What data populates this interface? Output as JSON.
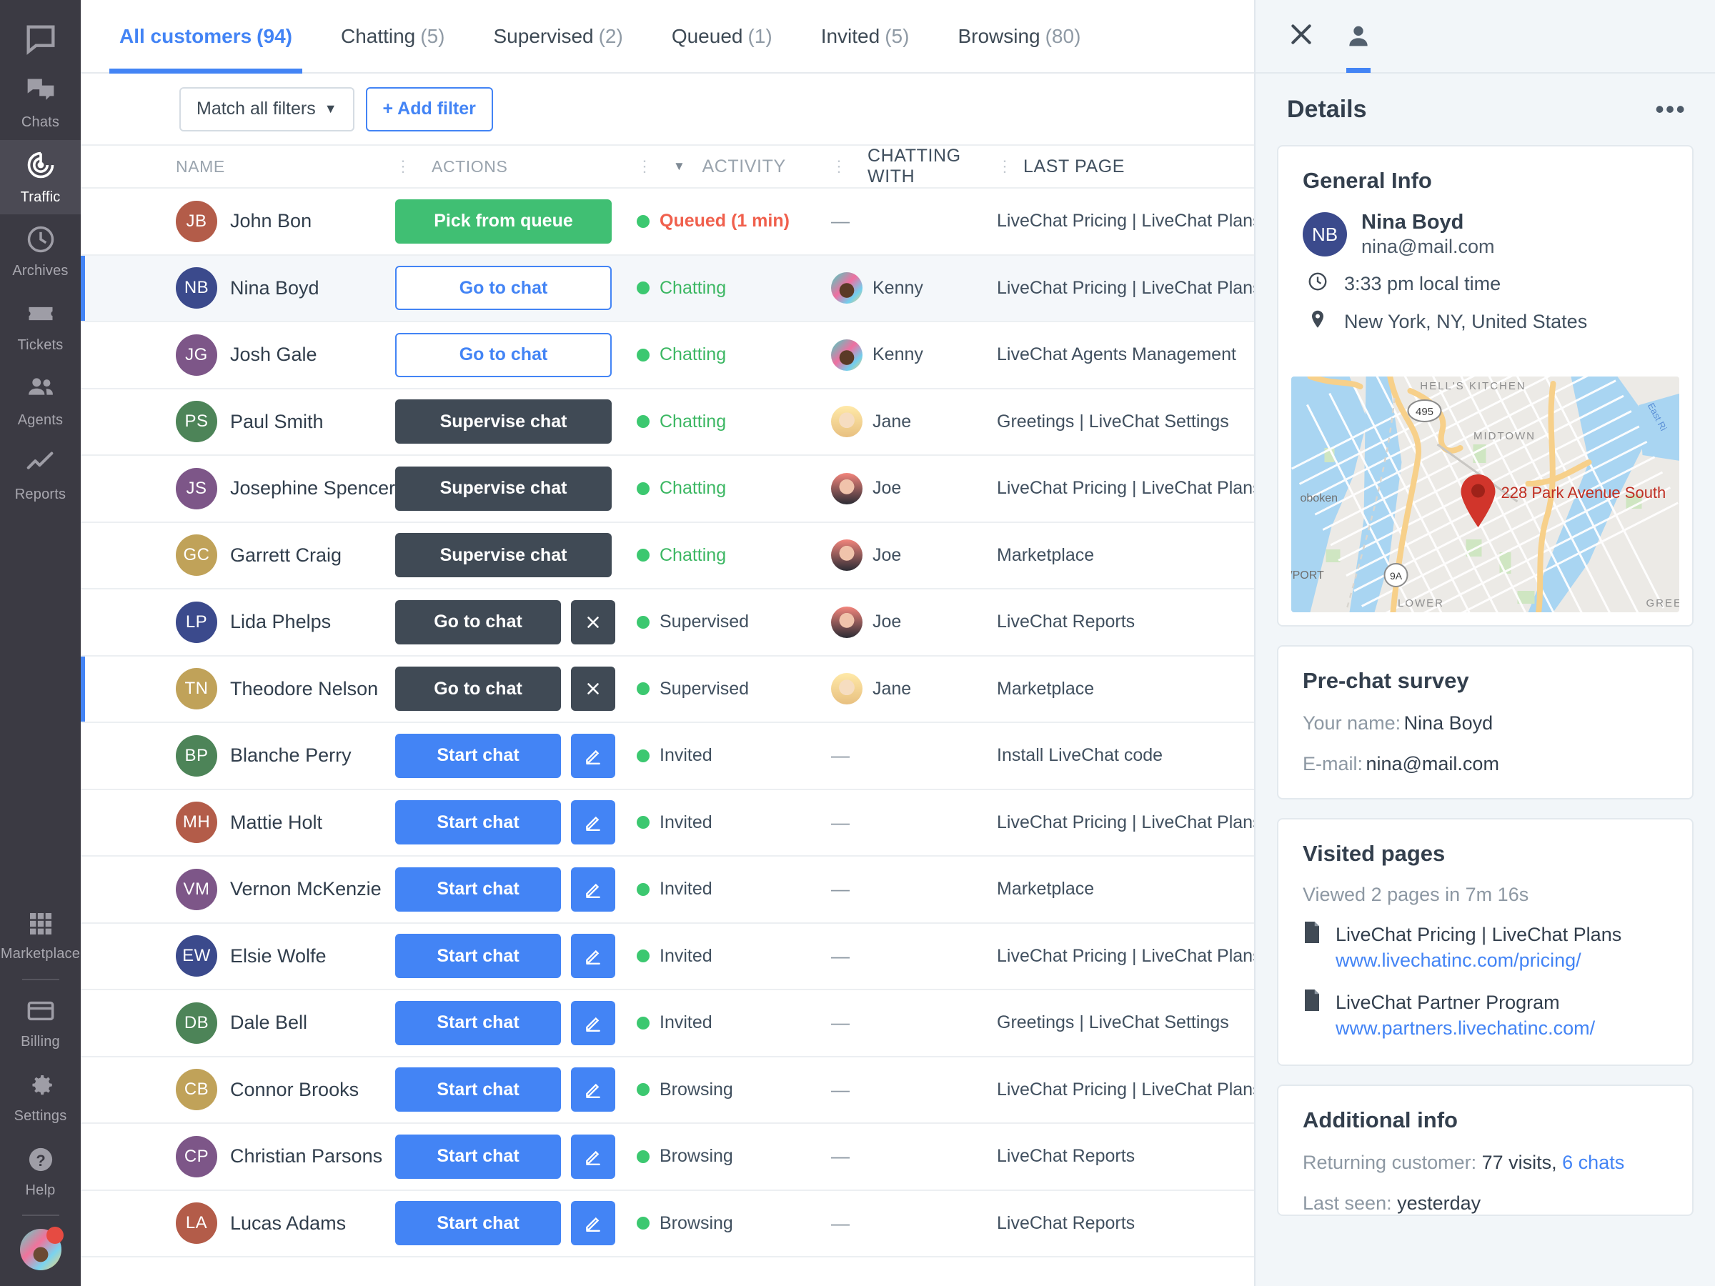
{
  "colors": {
    "accent": "#4384f5",
    "green": "#40bf73",
    "dark": "#404a55",
    "red": "#f0604d",
    "navbg": "#3b3a43"
  },
  "sidebar": {
    "logo_icon": "livechat-logo-icon",
    "items": [
      {
        "label": "Chats",
        "icon": "chats-icon",
        "active": false
      },
      {
        "label": "Traffic",
        "icon": "traffic-icon",
        "active": true
      },
      {
        "label": "Archives",
        "icon": "archives-icon",
        "active": false
      },
      {
        "label": "Tickets",
        "icon": "tickets-icon",
        "active": false
      },
      {
        "label": "Agents",
        "icon": "agents-icon",
        "active": false
      },
      {
        "label": "Reports",
        "icon": "reports-icon",
        "active": false
      }
    ],
    "bottom_items": [
      {
        "label": "Marketplace",
        "icon": "marketplace-icon"
      },
      {
        "label": "Billing",
        "icon": "billing-icon"
      },
      {
        "label": "Settings",
        "icon": "settings-gear-icon"
      },
      {
        "label": "Help",
        "icon": "help-question-icon"
      }
    ]
  },
  "tabs": [
    {
      "label": "All customers",
      "count": "(94)",
      "active": true
    },
    {
      "label": "Chatting",
      "count": "(5)",
      "active": false
    },
    {
      "label": "Supervised",
      "count": "(2)",
      "active": false
    },
    {
      "label": "Queued",
      "count": "(1)",
      "active": false
    },
    {
      "label": "Invited",
      "count": "(5)",
      "active": false
    },
    {
      "label": "Browsing",
      "count": "(80)",
      "active": false
    }
  ],
  "filters": {
    "match_label": "Match all filters",
    "match_caret": "▼",
    "add_label": "+ Add filter"
  },
  "table": {
    "headers": [
      {
        "label": "NAME",
        "sorted": false
      },
      {
        "label": "ACTIONS",
        "sorted": false
      },
      {
        "label": "ACTIVITY",
        "sorted": true
      },
      {
        "label": "CHATTING WITH",
        "sorted": false
      },
      {
        "label": "LAST PAGE",
        "sorted": false
      }
    ],
    "rows": [
      {
        "initials": "JB",
        "name": "John Bon",
        "avatar_color": "#b35c49",
        "action": "Pick from queue",
        "action_style": "green",
        "action_width": "wide",
        "secondary": null,
        "activity": "Queued (1 min)",
        "activity_style": "queued",
        "with": "—",
        "with_avatar": null,
        "last_page": "LiveChat Pricing | LiveChat Plans - Cu",
        "selected": false
      },
      {
        "initials": "NB",
        "name": "Nina Boyd",
        "avatar_color": "#3b4a8c",
        "action": "Go to chat",
        "action_style": "ghost",
        "action_width": "wide",
        "secondary": null,
        "activity": "Chatting",
        "activity_style": "chatting",
        "with": "Kenny",
        "with_avatar": "kenny",
        "last_page": "LiveChat Pricing | LiveChat Plans",
        "selected": true
      },
      {
        "initials": "JG",
        "name": "Josh Gale",
        "avatar_color": "#7d5688",
        "action": "Go to chat",
        "action_style": "ghost",
        "action_width": "wide",
        "secondary": null,
        "activity": "Chatting",
        "activity_style": "chatting",
        "with": "Kenny",
        "with_avatar": "kenny",
        "last_page": "LiveChat Agents Management",
        "selected": false
      },
      {
        "initials": "PS",
        "name": "Paul Smith",
        "avatar_color": "#4d8458",
        "action": "Supervise chat",
        "action_style": "dark",
        "action_width": "wide",
        "secondary": null,
        "activity": "Chatting",
        "activity_style": "chatting",
        "with": "Jane",
        "with_avatar": "jane",
        "last_page": "Greetings | LiveChat Settings",
        "selected": false
      },
      {
        "initials": "JS",
        "name": "Josephine Spencer",
        "avatar_color": "#7d5688",
        "action": "Supervise chat",
        "action_style": "dark",
        "action_width": "wide",
        "secondary": null,
        "activity": "Chatting",
        "activity_style": "chatting",
        "with": "Joe",
        "with_avatar": "joe",
        "last_page": "LiveChat Pricing | LiveChat Plans - Cu",
        "selected": false
      },
      {
        "initials": "GC",
        "name": "Garrett Craig",
        "avatar_color": "#c0a259",
        "action": "Supervise chat",
        "action_style": "dark",
        "action_width": "wide",
        "secondary": null,
        "activity": "Chatting",
        "activity_style": "chatting",
        "with": "Joe",
        "with_avatar": "joe",
        "last_page": "Marketplace",
        "selected": false
      },
      {
        "initials": "LP",
        "name": "Lida Phelps",
        "avatar_color": "#3b4a8c",
        "action": "Go to chat",
        "action_style": "dark",
        "action_width": "narrow",
        "secondary": "close",
        "activity": "Supervised",
        "activity_style": "plain",
        "with": "Joe",
        "with_avatar": "joe",
        "last_page": "LiveChat Reports",
        "selected": false
      },
      {
        "initials": "TN",
        "name": "Theodore Nelson",
        "avatar_color": "#c0a259",
        "action": "Go to chat",
        "action_style": "dark",
        "action_width": "narrow",
        "secondary": "close",
        "activity": "Supervised",
        "activity_style": "plain",
        "with": "Jane",
        "with_avatar": "jane",
        "last_page": "Marketplace",
        "selected": false,
        "highlight": true
      },
      {
        "initials": "BP",
        "name": "Blanche Perry",
        "avatar_color": "#4d8458",
        "action": "Start chat",
        "action_style": "blue",
        "action_width": "narrow",
        "secondary": "edit",
        "activity": "Invited",
        "activity_style": "plain",
        "with": "—",
        "with_avatar": null,
        "last_page": "Install LiveChat code",
        "selected": false
      },
      {
        "initials": "MH",
        "name": "Mattie Holt",
        "avatar_color": "#b35c49",
        "action": "Start chat",
        "action_style": "blue",
        "action_width": "narrow",
        "secondary": "edit",
        "activity": "Invited",
        "activity_style": "plain",
        "with": "—",
        "with_avatar": null,
        "last_page": "LiveChat Pricing | LiveChat Plans - Cu",
        "selected": false
      },
      {
        "initials": "VM",
        "name": "Vernon McKenzie",
        "avatar_color": "#7d5688",
        "action": "Start chat",
        "action_style": "blue",
        "action_width": "narrow",
        "secondary": "edit",
        "activity": "Invited",
        "activity_style": "plain",
        "with": "—",
        "with_avatar": null,
        "last_page": "Marketplace",
        "selected": false
      },
      {
        "initials": "EW",
        "name": "Elsie Wolfe",
        "avatar_color": "#3b4a8c",
        "action": "Start chat",
        "action_style": "blue",
        "action_width": "narrow",
        "secondary": "edit",
        "activity": "Invited",
        "activity_style": "plain",
        "with": "—",
        "with_avatar": null,
        "last_page": "LiveChat Pricing | LiveChat Plans - Cu",
        "selected": false
      },
      {
        "initials": "DB",
        "name": "Dale Bell",
        "avatar_color": "#4d8458",
        "action": "Start chat",
        "action_style": "blue",
        "action_width": "narrow",
        "secondary": "edit",
        "activity": "Invited",
        "activity_style": "plain",
        "with": "—",
        "with_avatar": null,
        "last_page": "Greetings | LiveChat Settings",
        "selected": false
      },
      {
        "initials": "CB",
        "name": "Connor Brooks",
        "avatar_color": "#c0a259",
        "action": "Start chat",
        "action_style": "blue",
        "action_width": "narrow",
        "secondary": "edit",
        "activity": "Browsing",
        "activity_style": "plain",
        "with": "—",
        "with_avatar": null,
        "last_page": "LiveChat Pricing | LiveChat Plans - Cu",
        "selected": false
      },
      {
        "initials": "CP",
        "name": "Christian Parsons",
        "avatar_color": "#7d5688",
        "action": "Start chat",
        "action_style": "blue",
        "action_width": "narrow",
        "secondary": "edit",
        "activity": "Browsing",
        "activity_style": "plain",
        "with": "—",
        "with_avatar": null,
        "last_page": "LiveChat Reports",
        "selected": false
      },
      {
        "initials": "LA",
        "name": "Lucas Adams",
        "avatar_color": "#b35c49",
        "action": "Start chat",
        "action_style": "blue",
        "action_width": "narrow",
        "secondary": "edit",
        "activity": "Browsing",
        "activity_style": "plain",
        "with": "—",
        "with_avatar": null,
        "last_page": "LiveChat Reports",
        "selected": false
      }
    ]
  },
  "details": {
    "close_icon": "close-icon",
    "person_icon": "person-icon",
    "title": "Details",
    "more_icon": "more-options-icon",
    "general": {
      "heading": "General Info",
      "initials": "NB",
      "name": "Nina Boyd",
      "email": "nina@mail.com",
      "time_icon": "clock-icon",
      "time": "3:33 pm local time",
      "location_icon": "location-pin-icon",
      "location": "New York, NY, United States",
      "map": {
        "marker_label": "228 Park Avenue South",
        "labels": [
          "HELL'S KITCHEN",
          "MIDTOWN",
          "495",
          "9A",
          "oboken",
          "WPORT",
          "LOWER",
          "GREENP",
          "East Ri"
        ]
      }
    },
    "survey": {
      "heading": "Pre-chat survey",
      "fields": [
        {
          "label": "Your name:",
          "value": "Nina Boyd"
        },
        {
          "label": "E-mail:",
          "value": "nina@mail.com"
        }
      ]
    },
    "visited": {
      "heading": "Visited pages",
      "summary": "Viewed 2 pages in 7m 16s",
      "pages": [
        {
          "icon": "page-icon",
          "title": "LiveChat Pricing | LiveChat Plans",
          "url": "www.livechatinc.com/pricing/"
        },
        {
          "icon": "page-icon",
          "title": "LiveChat Partner Program",
          "url": "www.partners.livechatinc.com/"
        }
      ]
    },
    "additional": {
      "heading": "Additional info",
      "returning_label": "Returning customer: ",
      "visits": "77 visits, ",
      "chats": "6 chats",
      "last_seen_label": "Last seen: ",
      "last_seen_value": "yesterday"
    }
  }
}
